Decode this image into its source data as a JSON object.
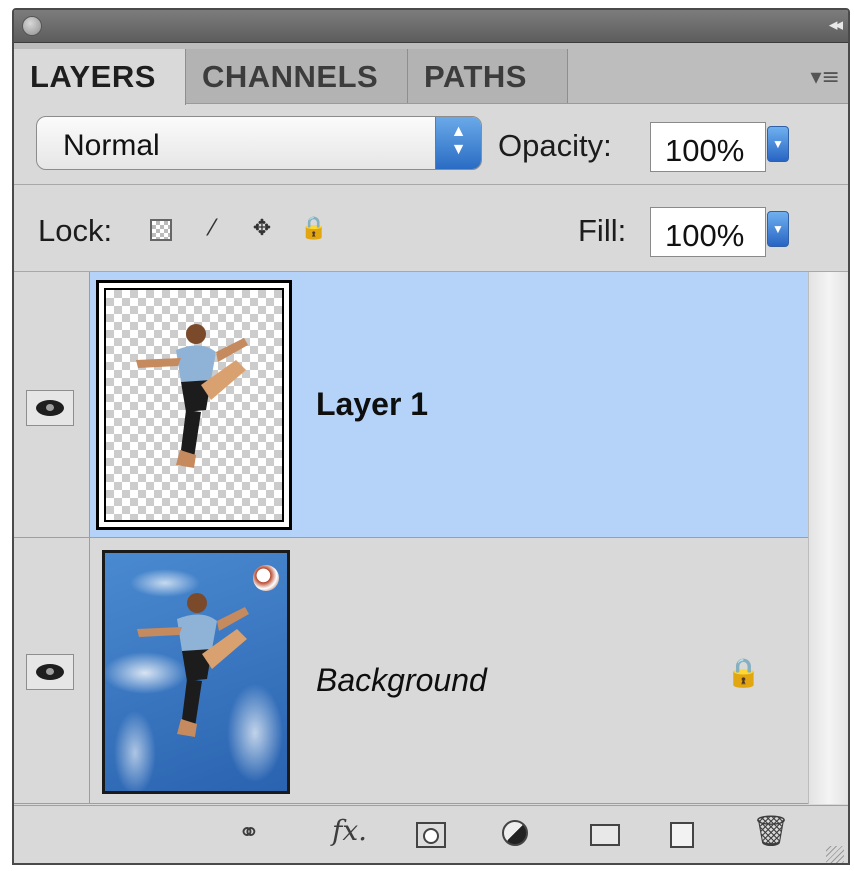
{
  "tabs": [
    {
      "label": "LAYERS",
      "active": true
    },
    {
      "label": "CHANNELS",
      "active": false
    },
    {
      "label": "PATHS",
      "active": false
    }
  ],
  "blend_mode": {
    "value": "Normal"
  },
  "opacity": {
    "label": "Opacity:",
    "value": "100%"
  },
  "lock": {
    "label": "Lock:"
  },
  "fill": {
    "label": "Fill:",
    "value": "100%"
  },
  "layers": [
    {
      "name": "Layer 1",
      "visible": true,
      "selected": true,
      "locked": false
    },
    {
      "name": "Background",
      "visible": true,
      "selected": false,
      "locked": true
    }
  ],
  "footer_icons": [
    "link-icon",
    "fx-icon",
    "mask-icon",
    "adjustment-icon",
    "folder-icon",
    "new-layer-icon",
    "trash-icon"
  ],
  "colors": {
    "selection": "#b5d3f8",
    "panel": "#d9d9d9",
    "accent": "#2a6cc4"
  }
}
